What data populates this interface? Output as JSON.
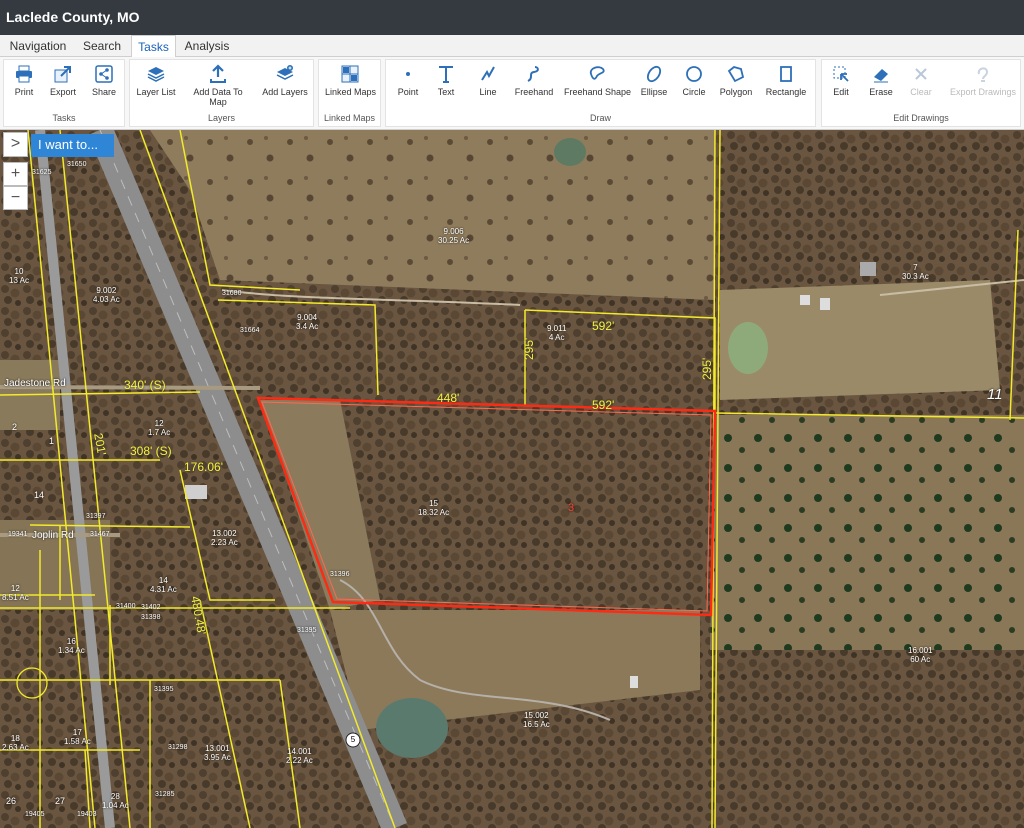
{
  "app": {
    "title": "Laclede County, MO"
  },
  "tabs": [
    "Navigation",
    "Search",
    "Tasks",
    "Analysis"
  ],
  "toolbar": {
    "groups": [
      "Tasks",
      "Layers",
      "Linked Maps",
      "Draw",
      "Edit Drawings"
    ],
    "tasks": [
      "Print",
      "Export",
      "Share"
    ],
    "layers": [
      "Layer List",
      "Add Data To Map",
      "Add Layers"
    ],
    "linked": [
      "Linked Maps"
    ],
    "draw": [
      "Point",
      "Text",
      "Line",
      "Freehand",
      "Freehand Shape",
      "Ellipse",
      "Circle",
      "Polygon",
      "Rectangle"
    ],
    "edit": [
      "Edit",
      "Erase",
      "Clear",
      "Export Drawings"
    ]
  },
  "map": {
    "i_want_to": "I want to...",
    "expand": ">",
    "zoom_in": "+",
    "zoom_out": "−",
    "route_shield": "5",
    "subject_number": "3",
    "parcels": [
      {
        "id": "9.006",
        "area": "30.25 Ac"
      },
      {
        "id": "7",
        "area": "30.3 Ac"
      },
      {
        "id": "10",
        "area": "13 Ac"
      },
      {
        "id": "9.002",
        "area": "4.03 Ac"
      },
      {
        "id": "9.004",
        "area": "3.4 Ac"
      },
      {
        "id": "9.011",
        "area": "4 Ac"
      },
      {
        "id": "12",
        "area": "1.7 Ac"
      },
      {
        "id": "15",
        "area": "18.32 Ac"
      },
      {
        "id": "13.002",
        "area": "2.23 Ac"
      },
      {
        "id": "14",
        "area": "4.31 Ac"
      },
      {
        "id": "12",
        "area": "8.51 Ac"
      },
      {
        "id": "16",
        "area": "1.34 Ac"
      },
      {
        "id": "15.002",
        "area": "16.5 Ac"
      },
      {
        "id": "16.001",
        "area": "60 Ac"
      },
      {
        "id": "18",
        "area": "2.63 Ac"
      },
      {
        "id": "17",
        "area": "1.58 Ac"
      },
      {
        "id": "13.001",
        "area": "3.95 Ac"
      },
      {
        "id": "14.001",
        "area": "2.22 Ac"
      },
      {
        "id": "28",
        "area": "1.04 Ac"
      }
    ],
    "lone_numbers": [
      "2",
      "1",
      "14",
      "26",
      "27",
      "11"
    ],
    "dimensions": [
      "592'",
      "295'",
      "295'",
      "448'",
      "592'",
      "340' (S)",
      "308' (S)",
      "176.06'",
      "480.48'",
      "201'"
    ],
    "roads": [
      "Jadestone Rd",
      "Joplin Rd"
    ],
    "addresses": [
      "31650",
      "31625",
      "31680",
      "31664",
      "31397",
      "31467",
      "31396",
      "31400",
      "31402",
      "31398",
      "31395",
      "31395",
      "31298",
      "31285",
      "19405",
      "19403",
      "19341"
    ]
  }
}
